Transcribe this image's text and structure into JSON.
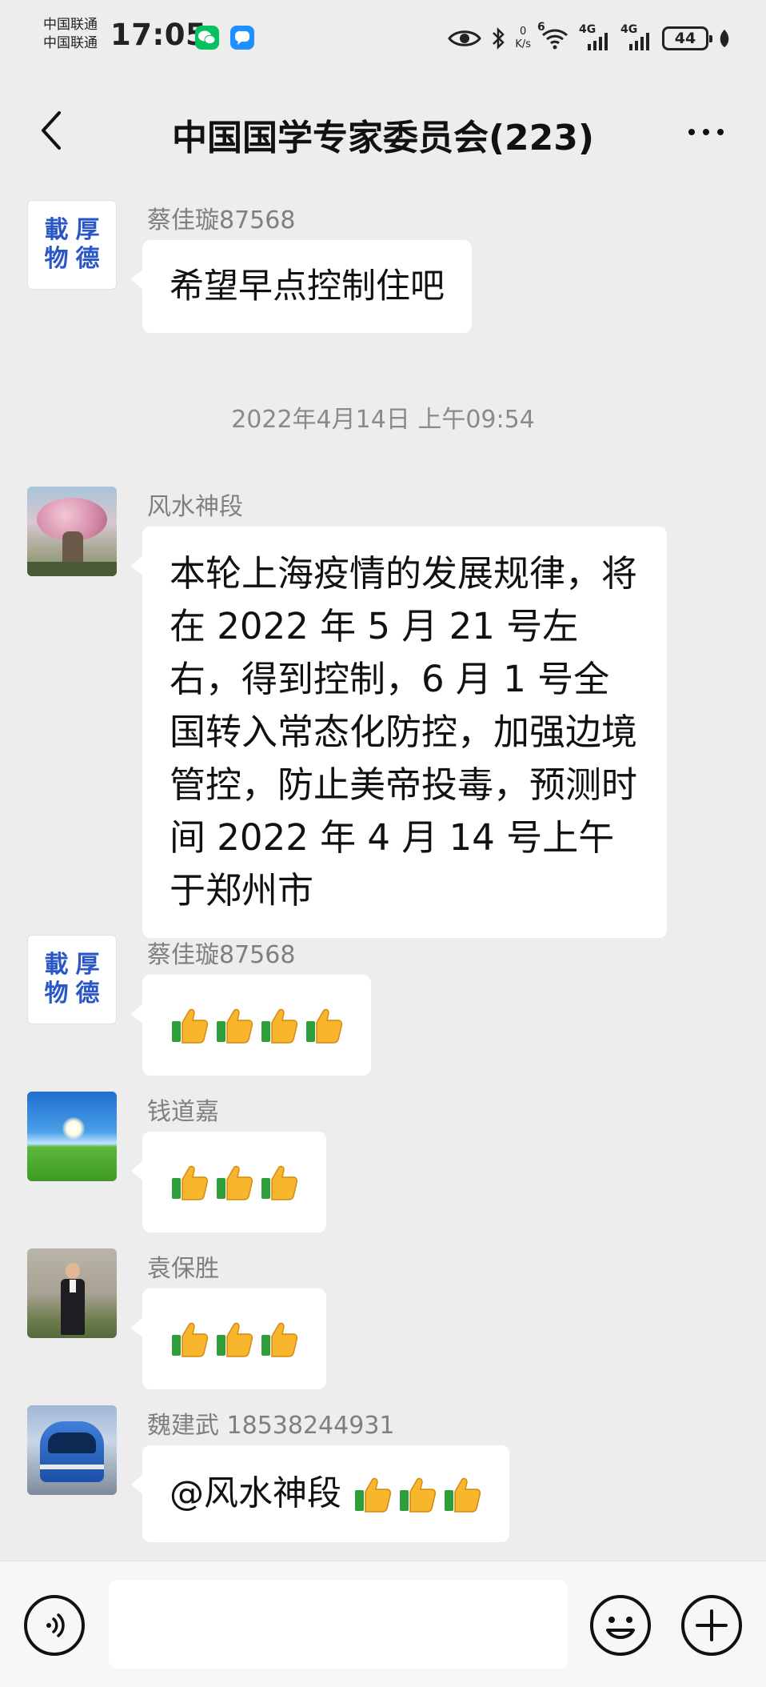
{
  "status_bar": {
    "carrier_1": "中国联通",
    "carrier_2": "中国联通",
    "time": "17:05",
    "net_speed_value": "0",
    "net_speed_unit": "K/s",
    "signal_1": "4G",
    "signal_2": "4G",
    "wifi_badge": "6",
    "battery": "44",
    "icons": [
      "wechat-icon",
      "message-icon",
      "eye-icon",
      "bluetooth-icon",
      "wifi-icon",
      "signal-icon",
      "battery-icon",
      "leaf-icon"
    ]
  },
  "nav": {
    "title": "中国国学专家委员会(223)",
    "icons": [
      "back-arrow-icon",
      "more-dots-icon"
    ]
  },
  "chat": {
    "messages": [
      {
        "sender": "蔡佳璇87568",
        "avatar_text": [
          "載",
          "厚",
          "物",
          "德"
        ],
        "text": "希望早点控制住吧"
      },
      {
        "sender": "风水神段",
        "text": "本轮上海疫情的发展规律，将在 2022 年 5 月 21 号左右，得到控制，6 月 1 号全国转入常态化防控，加强边境管控，防止美帝投毒，预测时间 2022 年 4 月 14 号上午于郑州市"
      },
      {
        "sender": "蔡佳璇87568",
        "avatar_text": [
          "載",
          "厚",
          "物",
          "德"
        ],
        "thumbs": 4
      },
      {
        "sender": "钱道嘉",
        "thumbs": 3
      },
      {
        "sender": "袁保胜",
        "thumbs": 3
      },
      {
        "sender": "魏建武 18538244931",
        "text": "@风水神段 ",
        "thumbs": 3
      }
    ],
    "timestamp": "2022年4月14日 上午09:54"
  },
  "input_bar": {
    "text_value": "",
    "icons": [
      "voice-icon",
      "emoji-icon",
      "plus-icon"
    ]
  },
  "colors": {
    "background": "#ededed",
    "bubble": "#ffffff",
    "sender_name": "#7f7f7f",
    "wechat_green": "#07c160",
    "calligraphy_blue": "#2a56c6"
  }
}
